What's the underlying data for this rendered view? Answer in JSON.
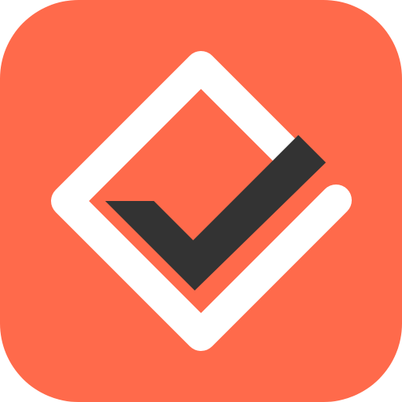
{
  "app_icon": {
    "icon": "checkmark-diamond-logo-icon",
    "colors": {
      "background": "#FF6A4B",
      "diamond_outline": "#FFFFFF",
      "checkmark": "#333333"
    }
  }
}
